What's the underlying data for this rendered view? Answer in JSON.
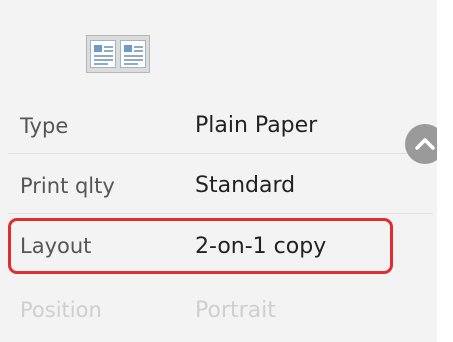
{
  "settings": [
    {
      "label": "Type",
      "value": "Plain Paper"
    },
    {
      "label": "Print qlty",
      "value": "Standard"
    },
    {
      "label": "Layout",
      "value": "2-on-1 copy"
    },
    {
      "label": "Position",
      "value": "Portrait"
    }
  ],
  "header_icon": "2-on-1-layout-icon",
  "scroll_icon": "chevron-up-icon",
  "colors": {
    "highlight": "#e02d2d",
    "background": "#f3f3f3",
    "scroll_button": "#9a9a9a"
  }
}
